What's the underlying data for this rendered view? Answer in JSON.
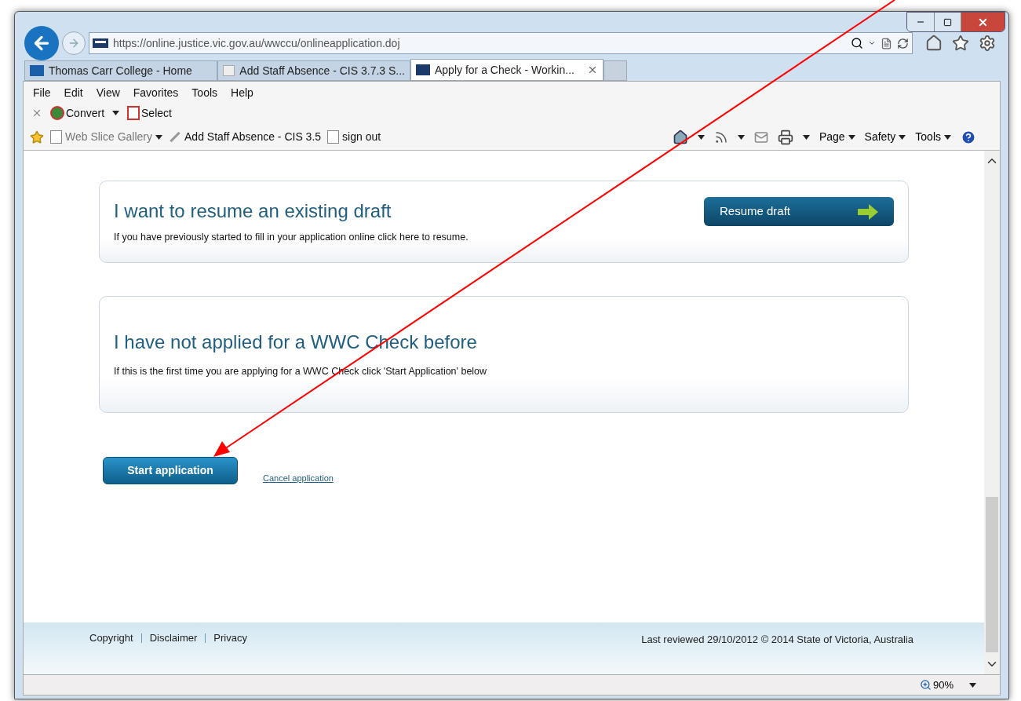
{
  "address_bar": {
    "url": "https://online.justice.vic.gov.au/wwccu/onlineapplication.doj"
  },
  "tabs": [
    {
      "label": "Thomas Carr College - Home",
      "selected": false
    },
    {
      "label": "Add Staff Absence - CIS 3.7.3 S...",
      "selected": false
    },
    {
      "label": "Apply for a Check - Workin...",
      "selected": true
    }
  ],
  "menu": [
    "File",
    "Edit",
    "View",
    "Favorites",
    "Tools",
    "Help"
  ],
  "toolbar": [
    "Convert",
    "Select"
  ],
  "favorites": [
    {
      "label": "Web Slice Gallery",
      "disabled": true
    },
    {
      "label": "Add Staff Absence - CIS 3.5",
      "disabled": false
    },
    {
      "label": "sign out",
      "disabled": false
    }
  ],
  "command_bar": [
    "Page",
    "Safety",
    "Tools"
  ],
  "cards": [
    {
      "title": "I want to resume an existing draft",
      "text": "If you have previously started to fill in your application online click here to resume.",
      "button": "Resume draft"
    },
    {
      "title": "I have not applied for a WWC Check before",
      "text": "If this is the first time you are applying for a WWC Check click 'Start Application' below"
    }
  ],
  "actions": {
    "primary": "Start application",
    "link": "Cancel application"
  },
  "footer": {
    "links": [
      "Copyright",
      "Disclaimer",
      "Privacy"
    ],
    "note": "Last reviewed 29/10/2012 © 2014 State of Victoria, Australia"
  },
  "status_bar": {
    "zoom": "90%"
  }
}
